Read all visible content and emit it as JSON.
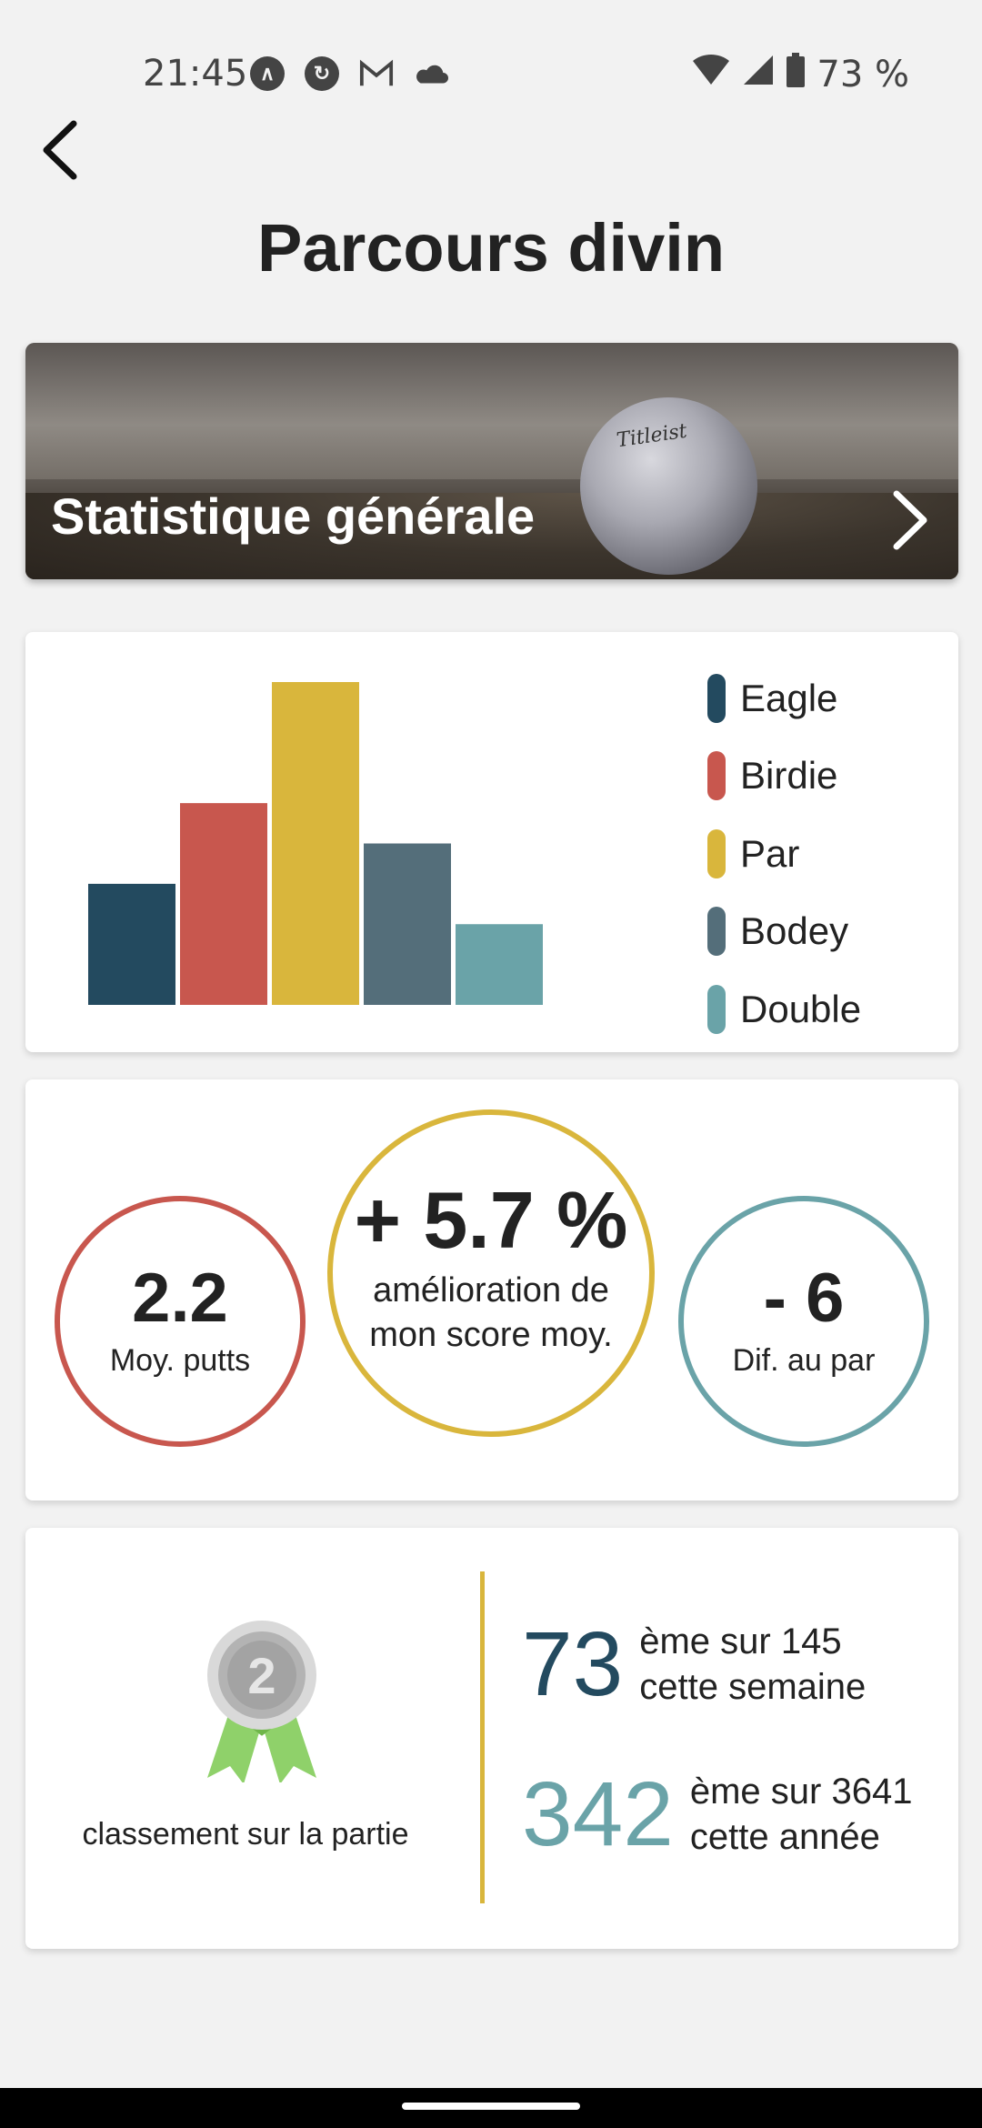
{
  "status_bar": {
    "time": "21:45",
    "battery": "73 %",
    "icons": [
      "arch-icon",
      "sync-icon",
      "gmail-icon",
      "cloud-icon",
      "wifi-icon",
      "signal-icon",
      "battery-icon"
    ]
  },
  "header": {
    "title": "Parcours divin"
  },
  "banner": {
    "title": "Statistique générale",
    "ball_brand": "Titleist"
  },
  "chart_data": {
    "type": "bar",
    "categories": [
      "Eagle",
      "Birdie",
      "Par",
      "Bodey",
      "Double"
    ],
    "values": [
      3,
      5,
      8,
      4,
      2
    ],
    "colors": [
      "#234a5f",
      "#c8574e",
      "#d9b63c",
      "#546e7a",
      "#6aa3a8"
    ],
    "ylim": [
      0,
      8
    ],
    "legend_position": "right",
    "title": "",
    "xlabel": "",
    "ylabel": ""
  },
  "stats": {
    "putts": {
      "value": "2.2",
      "label": "Moy. putts"
    },
    "improvement": {
      "value": "+ 5.7 %",
      "label": "amélioration de mon score moy."
    },
    "par_diff": {
      "value": "- 6",
      "label": "Dif. au par"
    }
  },
  "ranking": {
    "medal_number": "2",
    "caption": "classement sur la partie",
    "week": {
      "rank": "73",
      "text_line1": "ème sur 145",
      "text_line2": "cette semaine"
    },
    "year": {
      "rank": "342",
      "text_line1": "ème sur 3641",
      "text_line2": "cette année"
    }
  },
  "colors": {
    "navy": "#234a5f",
    "red": "#c8574e",
    "gold": "#d9b63c",
    "slate": "#546e7a",
    "teal": "#6aa3a8"
  }
}
